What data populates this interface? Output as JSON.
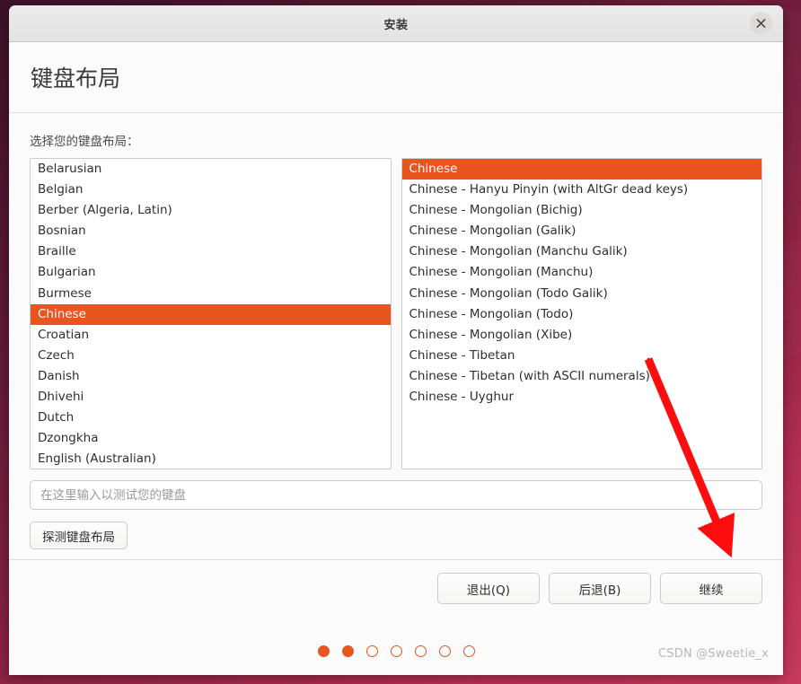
{
  "window": {
    "title": "安装",
    "close_icon": "close-icon"
  },
  "header": {
    "page_title": "键盘布局"
  },
  "form": {
    "label": "选择您的键盘布局：",
    "test_input_placeholder": "在这里输入以测试您的键盘",
    "test_input_value": "",
    "detect_button_label": "探测键盘布局"
  },
  "layout_list": {
    "selected": "Chinese",
    "items": [
      "Belarusian",
      "Belgian",
      "Berber (Algeria, Latin)",
      "Bosnian",
      "Braille",
      "Bulgarian",
      "Burmese",
      "Chinese",
      "Croatian",
      "Czech",
      "Danish",
      "Dhivehi",
      "Dutch",
      "Dzongkha",
      "English (Australian)"
    ]
  },
  "variant_list": {
    "selected": "Chinese",
    "items": [
      "Chinese",
      "Chinese - Hanyu Pinyin (with AltGr dead keys)",
      "Chinese - Mongolian (Bichig)",
      "Chinese - Mongolian (Galik)",
      "Chinese - Mongolian (Manchu Galik)",
      "Chinese - Mongolian (Manchu)",
      "Chinese - Mongolian (Todo Galik)",
      "Chinese - Mongolian (Todo)",
      "Chinese - Mongolian (Xibe)",
      "Chinese - Tibetan",
      "Chinese - Tibetan (with ASCII numerals)",
      "Chinese - Uyghur"
    ]
  },
  "footer": {
    "quit_label": "退出(Q)",
    "back_label": "后退(B)",
    "continue_label": "继续"
  },
  "progress": {
    "total": 7,
    "completed": 2
  },
  "watermark": {
    "text": "CSDN @Sweetie_x"
  },
  "colors": {
    "accent": "#e8551f",
    "annotation": "#fd0d0d",
    "desktop": "#7a1f3f"
  }
}
